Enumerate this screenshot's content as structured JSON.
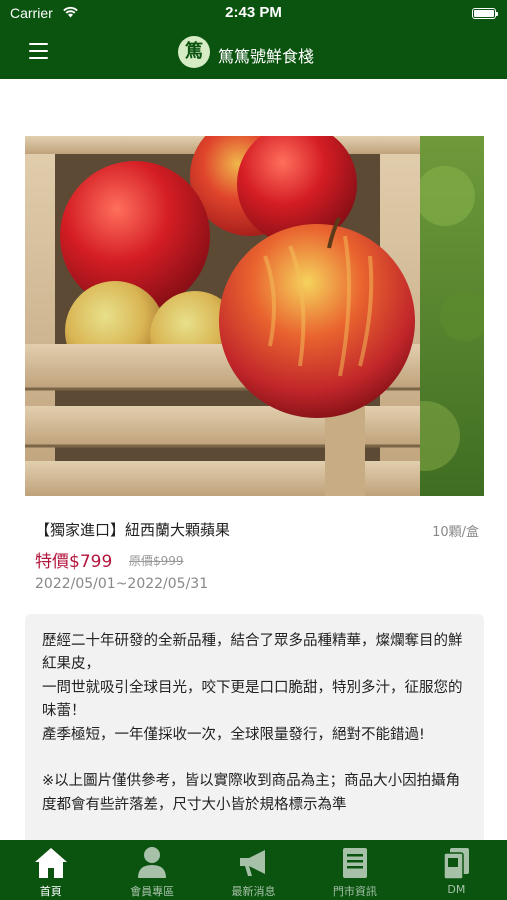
{
  "status_bar": {
    "carrier": "Carrier",
    "time": "2:43 PM"
  },
  "header": {
    "logo_text": "篤",
    "brand": "篤篤號鮮食棧"
  },
  "product": {
    "title": "【獨家進口】紐西蘭大顆蘋果",
    "unit": "10顆/盒",
    "sale_price": "特價$799",
    "original_price": "原價$999",
    "date_range": "2022/05/01~2022/05/31",
    "description": "歷經二十年研發的全新品種，結合了眾多品種精華，燦爛奪目的鮮紅果皮，\n一問世就吸引全球目光，咬下更是口口脆甜，特別多汁，征服您的味蕾！\n產季極短，一年僅採收一次，全球限量發行，絕對不能錯過!\n\n※以上圖片僅供參考，皆以實際收到商品為主；商品大小因拍攝角度都會有些許落差，尺寸大小皆於規格標示為準"
  },
  "tabs": [
    {
      "label": "首頁",
      "icon": "home-icon",
      "active": true
    },
    {
      "label": "會員專區",
      "icon": "member-icon",
      "active": false
    },
    {
      "label": "最新消息",
      "icon": "megaphone-icon",
      "active": false
    },
    {
      "label": "門市資訊",
      "icon": "store-info-icon",
      "active": false
    },
    {
      "label": "DM",
      "icon": "dm-icon",
      "active": false
    }
  ],
  "colors": {
    "brand_green": "#0b5410",
    "price_red": "#b3163d",
    "tab_inactive": "#a7c1a9"
  }
}
